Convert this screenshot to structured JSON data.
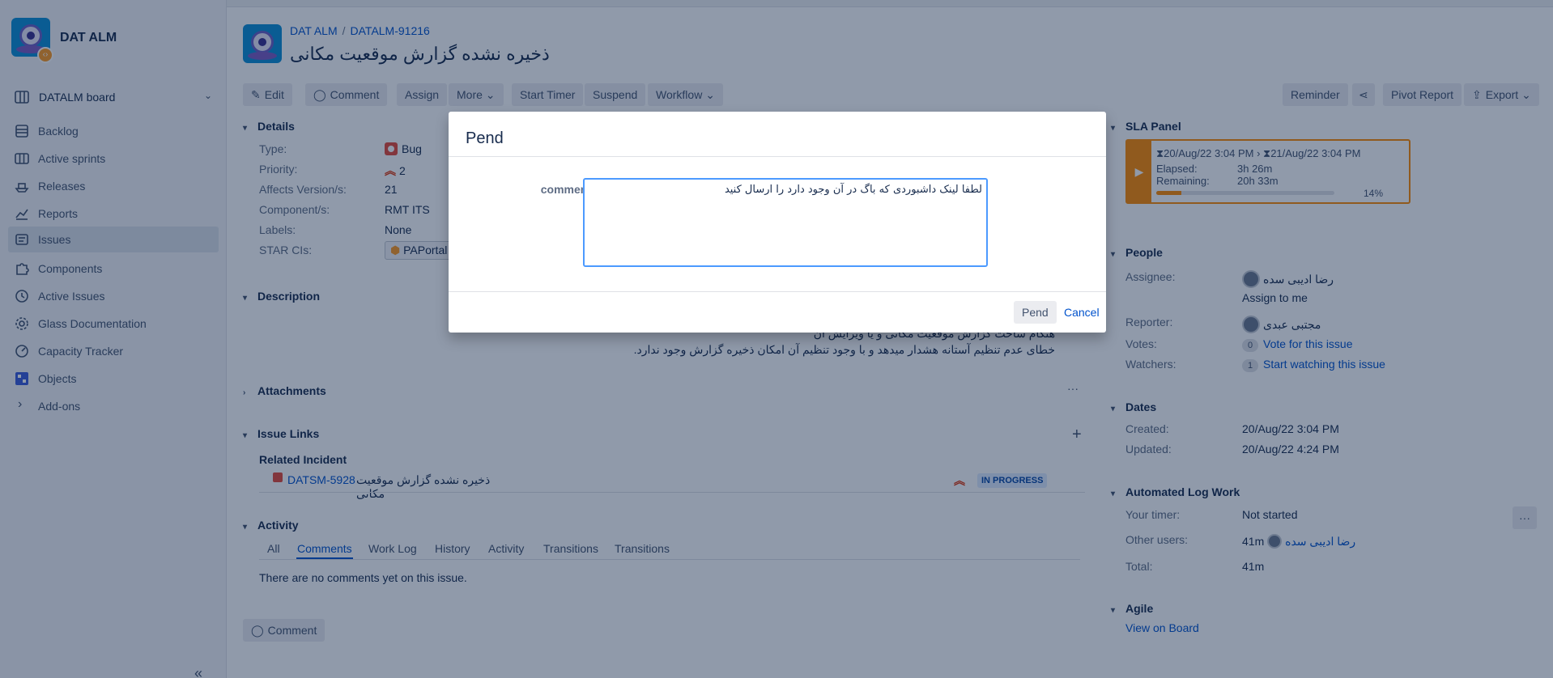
{
  "sidebar": {
    "project_name": "DAT ALM",
    "board_selector": "DATALM board",
    "items": [
      {
        "label": "Backlog"
      },
      {
        "label": "Active sprints"
      },
      {
        "label": "Releases"
      },
      {
        "label": "Reports"
      },
      {
        "label": "Issues"
      },
      {
        "label": "Components"
      },
      {
        "label": "Active Issues"
      },
      {
        "label": "Glass Documentation"
      },
      {
        "label": "Capacity Tracker"
      },
      {
        "label": "Objects"
      },
      {
        "label": "Add-ons"
      }
    ],
    "collapse_glyph": "«"
  },
  "issue": {
    "breadcrumb_project": "DAT ALM",
    "breadcrumb_key": "DATALM-91216",
    "title": "ذخیره نشده گزارش موقعیت مکانی"
  },
  "toolbar": {
    "edit": "Edit",
    "comment": "Comment",
    "assign": "Assign",
    "more": "More",
    "start_timer": "Start Timer",
    "suspend": "Suspend",
    "workflow": "Workflow",
    "reminder": "Reminder",
    "pivot_report": "Pivot Report",
    "export": "Export"
  },
  "details": {
    "heading": "Details",
    "type_label": "Type:",
    "type_value": "Bug",
    "priority_label": "Priority:",
    "priority_value": "2",
    "affects_label": "Affects Version/s:",
    "affects_value": "21",
    "component_label": "Component/s:",
    "component_value": "RMT ITS",
    "labels_label": "Labels:",
    "labels_value": "None",
    "star_label": "STAR CIs:",
    "star_value": "PAPortal"
  },
  "description": {
    "heading": "Description",
    "line1": "هنگام ساخت گزارش موقعیت مکانی و یا ویرایش آن",
    "line2": "خطای عدم تنظیم آستانه هشدار میدهد و با وجود تنظیم آن امکان ذخیره گزارش وجود ندارد."
  },
  "attachments": {
    "heading": "Attachments",
    "menu": "···"
  },
  "issue_links": {
    "heading": "Issue Links",
    "add": "+",
    "group": "Related Incident",
    "link_key": "DATSM-5928",
    "link_title": "ذخیره نشده گزارش موقعیت مکانی",
    "status": "IN PROGRESS"
  },
  "activity": {
    "heading": "Activity",
    "tabs": [
      "All",
      "Comments",
      "Work Log",
      "History",
      "Activity",
      "Transitions",
      "Transitions"
    ],
    "empty": "There are no comments yet on this issue.",
    "comment_button": "Comment"
  },
  "sla": {
    "heading": "SLA Panel",
    "start": "20/Aug/22 3:04 PM",
    "end": "21/Aug/22 3:04 PM",
    "elapsed_label": "Elapsed:",
    "elapsed_value": "3h 26m",
    "remaining_label": "Remaining:",
    "remaining_value": "20h 33m",
    "percent_text": "14%",
    "progress": 0.14,
    "color": "#ff8b00"
  },
  "people": {
    "heading": "People",
    "assignee_label": "Assignee:",
    "assignee_value": "رضا ادیبی سده",
    "assign_to_me": "Assign to me",
    "reporter_label": "Reporter:",
    "reporter_value": "مجتبی عبدی",
    "votes_label": "Votes:",
    "votes_count": "0",
    "votes_link": "Vote for this issue",
    "watchers_label": "Watchers:",
    "watchers_count": "1",
    "watchers_link": "Start watching this issue"
  },
  "dates": {
    "heading": "Dates",
    "created_label": "Created:",
    "created_value": "20/Aug/22 3:04 PM",
    "updated_label": "Updated:",
    "updated_value": "20/Aug/22 4:24 PM"
  },
  "log_work": {
    "heading": "Automated Log Work",
    "timer_label": "Your timer:",
    "timer_value": "Not started",
    "other_label": "Other users:",
    "other_time": "41m",
    "other_user": "رضا ادیبی سده",
    "total_label": "Total:",
    "total_value": "41m",
    "menu": "···"
  },
  "agile": {
    "heading": "Agile",
    "link": "View on Board"
  },
  "dialog": {
    "title": "Pend",
    "field_label": "comment",
    "comment_value": "لطفا لینک داشبوردی که باگ در آن وجود دارد را ارسال کنید",
    "submit": "Pend",
    "cancel": "Cancel"
  }
}
